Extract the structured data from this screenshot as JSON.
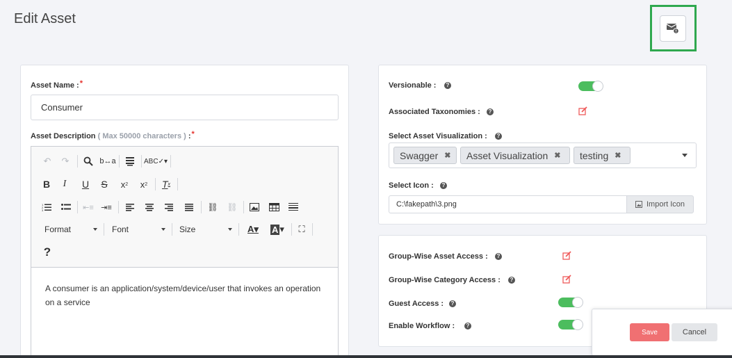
{
  "page": {
    "title": "Edit Asset"
  },
  "asset_name": {
    "label": "Asset Name :",
    "required": "*",
    "value": "Consumer"
  },
  "asset_description": {
    "label": "Asset Description",
    "hint": "( Max 50000 characters )",
    "suffix": " :",
    "required": "*",
    "text": "A consumer is an application/system/device/user that invokes an operation on a service"
  },
  "editor": {
    "format_label": "Format",
    "font_label": "Font",
    "size_label": "Size",
    "help_label": "?"
  },
  "versionable": {
    "label": "Versionable :",
    "value": true
  },
  "associated_taxonomies": {
    "label": "Associated Taxonomies :"
  },
  "asset_visualization": {
    "label": "Select Asset Visualization :",
    "selected": [
      "Swagger",
      "Asset Visualization",
      "testing"
    ],
    "remove_glyph": "✖"
  },
  "select_icon": {
    "label": "Select Icon :",
    "value": "C:\\fakepath\\3.png",
    "button": "Import Icon"
  },
  "group_asset_access": {
    "label": "Group-Wise Asset Access :"
  },
  "group_category_access": {
    "label": "Group-Wise Category Access :"
  },
  "guest_access": {
    "label": "Guest Access :",
    "value": true
  },
  "enable_workflow": {
    "label": "Enable Workflow :",
    "value": true
  },
  "actions": {
    "save": "Save",
    "cancel": "Cancel"
  },
  "colors": {
    "toggle_on": "#4cbd5e",
    "save": "#f07072",
    "required": "#e5322d",
    "highlight": "#2fa84f",
    "edit_icon": "#ef5a5a"
  }
}
